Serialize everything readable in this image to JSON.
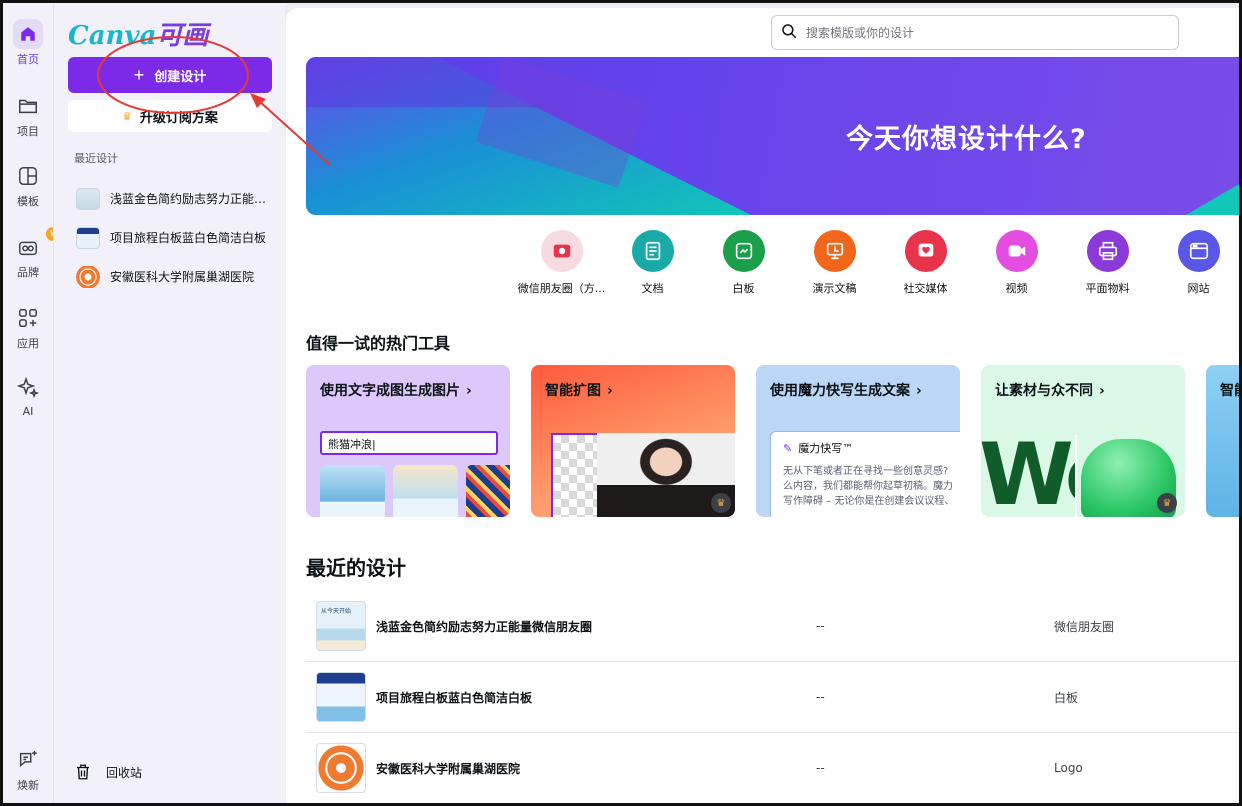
{
  "rail": [
    {
      "label": "首页",
      "icon": "home-icon"
    },
    {
      "label": "项目",
      "icon": "folder-icon"
    },
    {
      "label": "模板",
      "icon": "template-icon"
    },
    {
      "label": "品牌",
      "icon": "brand-icon"
    },
    {
      "label": "应用",
      "icon": "apps-icon"
    },
    {
      "label": "AI",
      "icon": "sparkle-icon"
    },
    {
      "label": "焕新",
      "icon": "whats-new-icon"
    }
  ],
  "sidebar": {
    "logo_latin": "Canva",
    "logo_cn": "可画",
    "create_label": "创建设计",
    "upgrade_label": "升级订阅方案",
    "recent_label": "最近设计",
    "recent_items": [
      {
        "label": "浅蓝金色简约励志努力正能量微信朋友圈"
      },
      {
        "label": "项目旅程白板蓝白色简洁白板"
      },
      {
        "label": "安徽医科大学附属巢湖医院"
      }
    ],
    "trash_label": "回收站"
  },
  "search": {
    "placeholder": "搜索模版或你的设计"
  },
  "hero": {
    "title": "今天你想设计什么?"
  },
  "design_types": [
    {
      "label": "微信朋友圈（方...",
      "color": "#f7dbe0",
      "icon": "wechat-moments-icon"
    },
    {
      "label": "文档",
      "color": "#1aa9a9",
      "icon": "doc-icon"
    },
    {
      "label": "白板",
      "color": "#1b9f4b",
      "icon": "whiteboard-icon"
    },
    {
      "label": "演示文稿",
      "color": "#f2661c",
      "icon": "presentation-icon"
    },
    {
      "label": "社交媒体",
      "color": "#e8344b",
      "icon": "social-heart-icon"
    },
    {
      "label": "视频",
      "color": "#e34ee0",
      "icon": "video-icon"
    },
    {
      "label": "平面物料",
      "color": "#8b3ad8",
      "icon": "print-icon"
    },
    {
      "label": "网站",
      "color": "#5a56e6",
      "icon": "website-icon"
    }
  ],
  "hot_tools": {
    "title": "值得一试的热门工具",
    "cards": [
      {
        "label": "使用文字成图生成图片",
        "input_text": "熊猫冲浪|"
      },
      {
        "label": "智能扩图"
      },
      {
        "label": "使用魔力快写生成文案",
        "panel_title": "魔力快写™",
        "panel_lines": [
          "无从下笔或者正在寻找一些创意灵感?",
          "么内容，我们都能帮你起草初稿。魔力",
          "写作障碍 – 无论你是在创建会议议程、"
        ]
      },
      {
        "label": "让素材与众不同",
        "art_text": "WoW!"
      },
      {
        "label": "智能"
      }
    ]
  },
  "recent_designs": {
    "title": "最近的设计",
    "rows": [
      {
        "name": "浅蓝金色简约励志努力正能量微信朋友圈",
        "date": "--",
        "type": "微信朋友圈",
        "thumb_text": "从今天开始"
      },
      {
        "name": "项目旅程白板蓝白色简洁白板",
        "date": "--",
        "type": "白板"
      },
      {
        "name": "安徽医科大学附属巢湖医院",
        "date": "--",
        "type": "Logo"
      }
    ]
  }
}
